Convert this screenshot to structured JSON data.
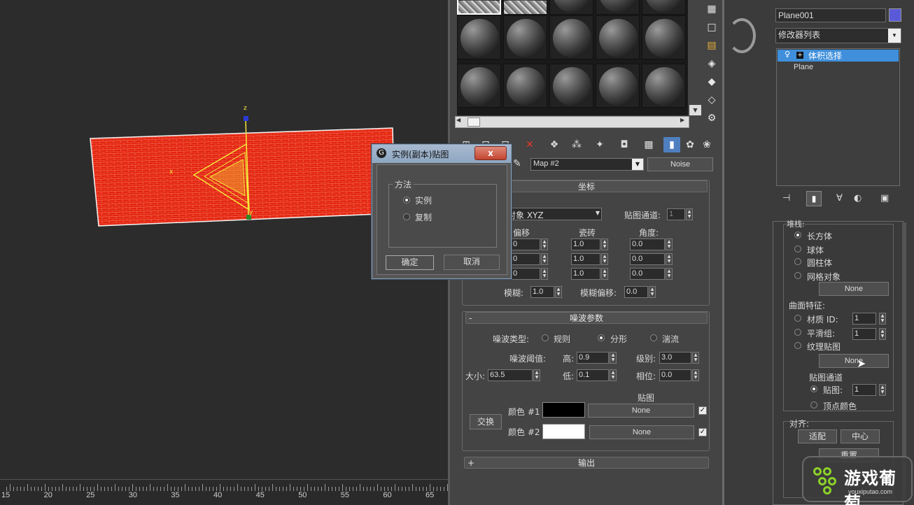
{
  "viewport": {
    "axis_x": "x",
    "axis_z": "z",
    "axis_y": "y",
    "colors": {
      "plane": "#e3230f",
      "gizmo": "#f4e83a",
      "arrow": "#e8332b"
    }
  },
  "ruler": {
    "labels": [
      "15",
      "20",
      "25",
      "30",
      "35",
      "40",
      "45",
      "50",
      "55",
      "60",
      "65"
    ]
  },
  "mated": {
    "toolbar": {
      "map_name": "Map #2",
      "map_type": "Noise"
    },
    "coords": {
      "title": "坐标",
      "source": "对象 XYZ",
      "map_channel_label": "贴图通道:",
      "map_channel": "1",
      "col_offset": "偏移",
      "col_tiling": "瓷砖",
      "col_angle": "角度:",
      "offset": [
        "0",
        "0",
        "0"
      ],
      "tiling": [
        "1.0",
        "1.0",
        "1.0"
      ],
      "angle": [
        "0.0",
        "0.0",
        "0.0"
      ],
      "blur_label": "模糊:",
      "blur": "1.0",
      "blur_offset_label": "模糊偏移:",
      "blur_offset": "0.0"
    },
    "noise": {
      "title": "噪波参数",
      "collapse": "-",
      "type_label": "噪波类型:",
      "types": [
        "规则",
        "分形",
        "湍流"
      ],
      "threshold_label": "噪波阈值:",
      "high_label": "高:",
      "high": "0.9",
      "levels_label": "级别:",
      "levels": "3.0",
      "size_label": "大小:",
      "size": "63.5",
      "low_label": "低:",
      "low": "0.1",
      "phase_label": "相位:",
      "phase": "0.0",
      "maps_label": "贴图",
      "swap": "交换",
      "color1_label": "颜色 #1",
      "color2_label": "颜色 #2",
      "color1": "#000000",
      "color2": "#ffffff",
      "map1": "None",
      "map2": "None"
    },
    "output": {
      "title": "输出",
      "expand": "+"
    }
  },
  "dialog": {
    "title": "实例(副本)贴图",
    "close": "x",
    "group": "方法",
    "opt_instance": "实例",
    "opt_copy": "复制",
    "ok": "确定",
    "cancel": "取消"
  },
  "cmd": {
    "object_name": "Plane001",
    "object_color": "#5a5ad8",
    "modifier_list": "修改器列表",
    "stack": [
      "体积选择",
      "Plane"
    ],
    "params": {
      "stack_by": "堆栈:",
      "shapes": [
        "长方体",
        "球体",
        "圆柱体",
        "网格对象"
      ],
      "none_btn": "None",
      "surface_label": "曲面特征:",
      "mat_id_label": "材质 ID:",
      "mat_id": "1",
      "smooth_label": "平滑组:",
      "smooth": "1",
      "texmap_label": "纹理贴图",
      "texmap_btn": "None",
      "mapchan_label": "贴图通道",
      "map_label": "贴图:",
      "map_value": "1",
      "vertcolor_label": "顶点颜色",
      "align_label": "对齐:",
      "fit_btn": "适配",
      "center_btn": "中心",
      "reset_btn": "重置"
    }
  },
  "watermark": {
    "name": "游戏葡萄",
    "url": "youxiputao.com"
  }
}
